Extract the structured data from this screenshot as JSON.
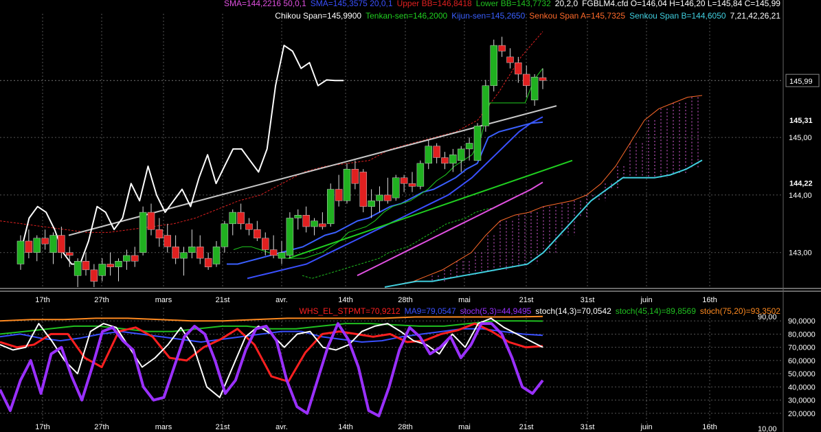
{
  "legend_main": {
    "row1": [
      {
        "text": "SMA=144,2216  50,0,1",
        "color": "#e050e0"
      },
      {
        "text": "SMA=145,3575  20,0,1",
        "color": "#3a50ff"
      },
      {
        "text": "Upper BB=146,8418",
        "color": "#e02020"
      },
      {
        "text": "Lower BB=143,7732",
        "color": "#20c020"
      },
      {
        "text": "20,2,0",
        "color": "#ffffff"
      },
      {
        "text": "FGBLM4.cfd O=146,04 H=146,20 L=145,84 C=145,99",
        "color": "#ffffff"
      }
    ],
    "row2": [
      {
        "text": "Chikou Span=145,9900",
        "color": "#ffffff"
      },
      {
        "text": "Tenkan-sen=146,2000",
        "color": "#20d020"
      },
      {
        "text": "Kijun-sen=145,2650",
        "color": "#3a60ff"
      },
      {
        "text": "Senkou Span A=145,7325",
        "color": "#ff6a2a"
      },
      {
        "text": "Senkou Span B=144,6050",
        "color": "#40d0e0"
      },
      {
        "text": "7,21,42,26,21",
        "color": "#ffffff"
      }
    ]
  },
  "legend_osc": [
    {
      "text": "WHS_EL_STPMT=70,9212",
      "color": "#ff2020"
    },
    {
      "text": "MA9=79,0547",
      "color": "#3a50ff"
    },
    {
      "text": "stoch(5,3)=44,9495",
      "color": "#9a30ff"
    },
    {
      "text": "stoch(14,3)=70,0542",
      "color": "#ffffff"
    },
    {
      "text": "stoch(45,14)=89,8569",
      "color": "#20c020"
    },
    {
      "text": "stoch(75,20)=93,3502",
      "color": "#ff8a20"
    }
  ],
  "price_axis": {
    "ticks": [
      "143,00",
      "144,00",
      "145,00"
    ],
    "badges": [
      {
        "text": "145,99",
        "value": 145.99,
        "color": "#ffffff",
        "bg": "#000000",
        "border": "#888888"
      },
      {
        "text": "145,31",
        "value": 145.31,
        "color": "#3a60ff",
        "bg": "#000000",
        "border": "#000000"
      },
      {
        "text": "144,22",
        "value": 144.22,
        "color": "#e050e0",
        "bg": "#000000",
        "border": "#000000"
      }
    ]
  },
  "osc_axis": {
    "ticks": [
      "90,0000",
      "80,0000",
      "70,0000",
      "60,0000",
      "50,0000",
      "40,0000",
      "30,0000",
      "20,0000"
    ],
    "ticks_values": [
      90,
      80,
      70,
      60,
      50,
      40,
      30,
      20
    ],
    "level_label": "90,00",
    "bottom_label": "10,00"
  },
  "date_axis": [
    "17th",
    "27th",
    "mars",
    "21st",
    "avr.",
    "14th",
    "28th",
    "mai",
    "21st",
    "31st",
    "juin",
    "16th"
  ],
  "chart_data": {
    "type": "candlestick",
    "instrument": "FGBLM4.cfd",
    "ohlc": {
      "O": 146.04,
      "H": 146.2,
      "L": 145.84,
      "C": 145.99
    },
    "candles": [
      [
        142.8,
        143.3,
        142.7,
        143.2
      ],
      [
        143.2,
        143.4,
        142.9,
        143.0
      ],
      [
        143.0,
        143.3,
        142.85,
        143.25
      ],
      [
        143.25,
        143.4,
        143.05,
        143.15
      ],
      [
        143.0,
        143.35,
        142.8,
        143.3
      ],
      [
        143.3,
        143.45,
        142.9,
        143.0
      ],
      [
        143.0,
        143.1,
        142.75,
        142.95
      ],
      [
        142.6,
        142.9,
        142.4,
        142.85
      ],
      [
        142.85,
        143.0,
        142.6,
        142.7
      ],
      [
        142.7,
        142.8,
        142.4,
        142.5
      ],
      [
        142.6,
        142.9,
        142.5,
        142.8
      ],
      [
        142.8,
        143.0,
        142.6,
        142.75
      ],
      [
        142.75,
        142.9,
        142.5,
        142.85
      ],
      [
        142.85,
        143.05,
        142.7,
        142.95
      ],
      [
        142.95,
        143.1,
        142.75,
        142.85
      ],
      [
        143.0,
        143.8,
        142.95,
        143.7
      ],
      [
        143.7,
        143.85,
        143.3,
        143.4
      ],
      [
        143.4,
        143.6,
        143.1,
        143.25
      ],
      [
        143.3,
        143.5,
        143.0,
        143.1
      ],
      [
        143.1,
        143.3,
        142.8,
        142.9
      ],
      [
        142.9,
        143.1,
        142.6,
        143.0
      ],
      [
        143.0,
        143.4,
        142.9,
        143.1
      ],
      [
        143.1,
        143.3,
        142.8,
        142.9
      ],
      [
        142.9,
        143.0,
        142.7,
        142.75
      ],
      [
        142.8,
        143.2,
        142.75,
        143.1
      ],
      [
        143.1,
        143.55,
        143.0,
        143.5
      ],
      [
        143.5,
        143.75,
        143.3,
        143.7
      ],
      [
        143.7,
        143.85,
        143.4,
        143.5
      ],
      [
        143.5,
        143.6,
        143.3,
        143.4
      ],
      [
        143.4,
        143.55,
        143.2,
        143.25
      ],
      [
        143.25,
        143.35,
        142.95,
        143.05
      ],
      [
        143.05,
        143.3,
        142.9,
        142.95
      ],
      [
        142.9,
        143.2,
        142.8,
        143.0
      ],
      [
        142.95,
        143.7,
        142.9,
        143.6
      ],
      [
        143.6,
        143.75,
        143.4,
        143.65
      ],
      [
        143.65,
        143.8,
        143.35,
        143.45
      ],
      [
        143.45,
        143.6,
        143.3,
        143.55
      ],
      [
        143.5,
        143.7,
        143.4,
        143.45
      ],
      [
        143.5,
        144.2,
        143.45,
        144.1
      ],
      [
        144.1,
        144.35,
        143.8,
        143.9
      ],
      [
        143.9,
        144.55,
        143.85,
        144.45
      ],
      [
        144.45,
        144.6,
        144.1,
        144.2
      ],
      [
        144.4,
        144.45,
        143.7,
        143.8
      ],
      [
        143.8,
        144.1,
        143.6,
        143.9
      ],
      [
        143.9,
        144.15,
        143.7,
        144.0
      ],
      [
        144.0,
        144.3,
        143.85,
        143.9
      ],
      [
        143.95,
        144.35,
        143.9,
        144.3
      ],
      [
        144.3,
        144.35,
        144.05,
        144.2
      ],
      [
        144.2,
        144.4,
        144.05,
        144.15
      ],
      [
        144.15,
        144.6,
        144.1,
        144.55
      ],
      [
        144.55,
        144.95,
        144.45,
        144.85
      ],
      [
        144.85,
        144.9,
        144.55,
        144.65
      ],
      [
        144.65,
        144.75,
        144.45,
        144.55
      ],
      [
        144.55,
        144.8,
        144.4,
        144.7
      ],
      [
        144.6,
        144.85,
        144.4,
        144.8
      ],
      [
        144.8,
        145.0,
        144.6,
        144.9
      ],
      [
        144.6,
        145.25,
        144.6,
        145.2
      ],
      [
        145.2,
        146.0,
        145.1,
        145.9
      ],
      [
        145.9,
        146.7,
        145.8,
        146.6
      ],
      [
        146.6,
        146.75,
        146.4,
        146.5
      ],
      [
        146.4,
        146.55,
        146.2,
        146.3
      ],
      [
        146.3,
        146.4,
        145.95,
        146.1
      ],
      [
        146.1,
        146.25,
        145.7,
        145.9
      ],
      [
        145.65,
        146.1,
        145.55,
        146.05
      ],
      [
        146.04,
        146.2,
        145.84,
        145.99
      ]
    ],
    "lines": {
      "chikou": [
        143.0,
        143.6,
        143.8,
        143.7,
        143.4,
        143.0,
        142.8,
        142.8,
        143.2,
        143.8,
        143.7,
        143.4,
        143.6,
        144.2,
        143.9,
        144.5,
        144.0,
        143.7,
        143.9,
        144.1,
        143.8,
        144.3,
        144.7,
        144.2,
        144.5,
        144.8,
        144.8,
        144.6,
        144.4,
        144.8,
        145.9,
        146.6,
        146.5,
        146.2,
        146.3,
        145.9,
        146.0,
        145.99,
        145.99
      ],
      "tenkan": [
        143.05,
        143.1,
        143.1,
        143.05,
        143.0,
        142.95,
        142.9,
        142.9,
        142.9,
        142.95,
        143.0,
        143.1,
        143.2,
        143.35,
        143.4,
        143.45,
        143.55,
        143.7,
        143.8,
        143.85,
        143.9,
        144.0,
        144.1,
        144.25,
        144.35,
        144.5,
        144.6,
        144.7,
        145.0,
        145.6,
        145.6,
        145.6,
        145.6,
        145.6,
        146.0,
        146.2
      ],
      "kijun": [
        142.8,
        142.8,
        142.85,
        142.9,
        142.95,
        143.0,
        143.05,
        143.1,
        143.2,
        143.3,
        143.35,
        143.45,
        143.55,
        143.6,
        143.7,
        143.8,
        143.85,
        143.95,
        144.05,
        144.1,
        144.2,
        144.3,
        144.45,
        144.55,
        145.0,
        145.1,
        145.15,
        145.2,
        145.25,
        145.265
      ],
      "upper_bb": [
        143.55,
        143.5,
        143.45,
        143.4,
        143.35,
        143.35,
        143.4,
        143.45,
        143.5,
        143.6,
        143.75,
        143.9,
        144.0,
        144.2,
        144.4,
        144.5,
        144.55,
        144.6,
        144.8,
        144.9,
        145.0,
        145.1,
        145.3,
        145.8,
        146.4,
        146.84
      ],
      "lower_bb": [
        142.6,
        142.55,
        142.6,
        142.65,
        142.7,
        142.75,
        142.8,
        142.85,
        142.9,
        143.0,
        143.05,
        143.1,
        143.2,
        143.3,
        143.4,
        143.5,
        143.55,
        143.6,
        143.7,
        143.75,
        143.7773
      ],
      "senkou_a": [
        142.4,
        142.45,
        142.5,
        142.6,
        142.7,
        142.85,
        143.0,
        143.3,
        143.55,
        143.65,
        143.7,
        143.8,
        143.85,
        143.9,
        144.0,
        144.2,
        144.5,
        144.9,
        145.3,
        145.5,
        145.6,
        145.7,
        145.73
      ],
      "senkou_b": [
        142.4,
        142.45,
        142.5,
        142.5,
        142.55,
        142.6,
        142.65,
        142.7,
        142.75,
        142.8,
        143.0,
        143.3,
        143.6,
        143.9,
        144.1,
        144.3,
        144.3,
        144.3,
        144.35,
        144.45,
        144.605
      ],
      "sma20": [
        142.55,
        142.6,
        142.65,
        142.7,
        142.75,
        142.8,
        142.9,
        143.0,
        143.1,
        143.2,
        143.3,
        143.4,
        143.5,
        143.6,
        143.7,
        143.8,
        143.9,
        144.0,
        144.15,
        144.3,
        144.5,
        144.7,
        144.9,
        145.1,
        145.25,
        145.3575
      ],
      "sma50": [
        142.6,
        142.7,
        142.8,
        142.9,
        143.0,
        143.1,
        143.2,
        143.3,
        143.4,
        143.5,
        143.6,
        143.7,
        143.8,
        143.9,
        144.0,
        144.1,
        144.2216
      ],
      "green_trend": [
        142.9,
        144.6
      ],
      "white_trend": [
        143.3,
        145.55
      ]
    },
    "oscillator": {
      "ylim": [
        10,
        100
      ],
      "stoch_5_3": [
        38,
        22,
        45,
        60,
        35,
        65,
        70,
        48,
        30,
        55,
        82,
        85,
        75,
        68,
        40,
        30,
        32,
        55,
        78,
        86,
        80,
        60,
        35,
        45,
        68,
        84,
        86,
        75,
        45,
        25,
        20,
        45,
        70,
        88,
        76,
        55,
        22,
        18,
        40,
        68,
        85,
        78,
        65,
        70,
        78,
        62,
        72,
        88,
        88,
        80,
        62,
        40,
        35,
        44.9495
      ],
      "stoch_14_3": [
        72,
        68,
        70,
        88,
        75,
        60,
        50,
        82,
        88,
        85,
        70,
        55,
        62,
        72,
        85,
        70,
        40,
        32,
        55,
        78,
        86,
        80,
        70,
        80,
        82,
        70,
        68,
        72,
        82,
        86,
        88,
        82,
        75,
        72,
        65,
        80,
        70,
        88,
        92,
        85,
        80,
        75,
        70.0542
      ],
      "whs_stpmt": [
        74,
        70,
        72,
        80,
        80,
        62,
        55,
        82,
        85,
        78,
        62,
        60,
        70,
        76,
        84,
        72,
        48,
        44,
        66,
        80,
        82,
        80,
        78,
        80,
        74,
        75,
        80,
        83,
        88,
        82,
        74,
        70,
        70.9212
      ],
      "ma9": [
        78,
        80,
        77,
        75,
        77,
        80,
        82,
        80,
        78,
        76,
        74,
        76,
        78,
        80,
        82,
        82,
        78,
        76,
        74,
        75,
        78,
        80,
        82,
        84,
        84,
        82,
        80,
        79.0547
      ],
      "stoch_45_14": [
        80,
        82,
        84,
        86,
        86,
        84,
        82,
        82,
        84,
        86,
        86,
        84,
        84,
        86,
        88,
        88,
        87,
        86,
        86,
        88,
        90,
        90,
        89.8569
      ],
      "stoch_75_20": [
        90,
        91,
        91,
        92,
        92,
        91,
        90,
        90,
        91,
        92,
        92,
        92,
        92,
        93,
        93,
        93,
        93,
        93.3502
      ]
    }
  }
}
